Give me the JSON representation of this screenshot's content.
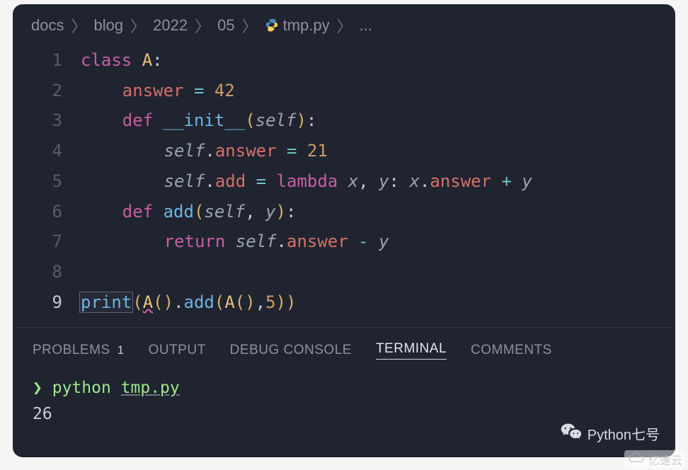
{
  "breadcrumb": {
    "items": [
      "docs",
      "blog",
      "2022",
      "05"
    ],
    "file_icon": "python-icon",
    "file": "tmp.py",
    "trailing": "..."
  },
  "code": {
    "active_line": 9,
    "tokens": {
      "class": "class",
      "A": "A",
      "answer": "answer",
      "eq": "=",
      "n42": "42",
      "def": "def",
      "init": "__init__",
      "self": "self",
      "n21": "21",
      "add": "add",
      "lambda": "lambda",
      "x": "x",
      "y": "y",
      "plus": "+",
      "minus": "-",
      "return": "return",
      "print": "print",
      "n5": "5",
      "colon": ":",
      "comma": ",",
      "lp": "(",
      "rp": ")",
      "dot": "."
    },
    "line_numbers": [
      "1",
      "2",
      "3",
      "4",
      "5",
      "6",
      "7",
      "8",
      "9"
    ]
  },
  "panel": {
    "tabs": [
      {
        "label": "PROBLEMS",
        "badge": "1",
        "active": false
      },
      {
        "label": "OUTPUT",
        "badge": "",
        "active": false
      },
      {
        "label": "DEBUG CONSOLE",
        "badge": "",
        "active": false
      },
      {
        "label": "TERMINAL",
        "badge": "",
        "active": true
      },
      {
        "label": "COMMENTS",
        "badge": "",
        "active": false
      }
    ]
  },
  "terminal": {
    "prompt": "❯",
    "command": "python",
    "arg": "tmp.py",
    "output": "26"
  },
  "watermarks": {
    "wechat": "Python七号",
    "corner": "亿速云"
  }
}
